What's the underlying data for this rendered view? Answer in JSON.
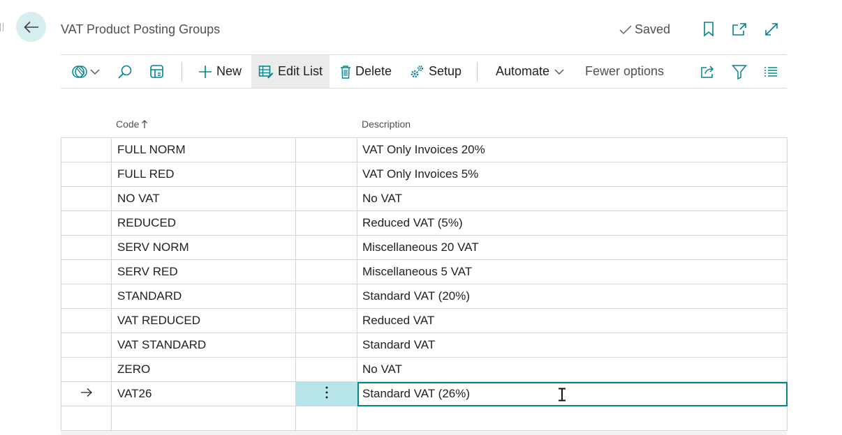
{
  "header": {
    "title": "VAT Product Posting Groups",
    "saved_label": "Saved"
  },
  "toolbar": {
    "new_label": "New",
    "edit_list_label": "Edit List",
    "delete_label": "Delete",
    "setup_label": "Setup",
    "automate_label": "Automate",
    "fewer_options_label": "Fewer options"
  },
  "grid": {
    "columns": {
      "code": "Code",
      "description": "Description"
    },
    "rows": [
      {
        "code": "FULL NORM",
        "description": "VAT Only Invoices 20%"
      },
      {
        "code": "FULL RED",
        "description": "VAT Only Invoices 5%"
      },
      {
        "code": "NO VAT",
        "description": "No VAT"
      },
      {
        "code": "REDUCED",
        "description": "Reduced VAT (5%)"
      },
      {
        "code": "SERV NORM",
        "description": "Miscellaneous 20 VAT"
      },
      {
        "code": "SERV RED",
        "description": "Miscellaneous 5 VAT"
      },
      {
        "code": "STANDARD",
        "description": "Standard VAT (20%)"
      },
      {
        "code": "VAT REDUCED",
        "description": "Reduced VAT"
      },
      {
        "code": "VAT STANDARD",
        "description": "Standard VAT"
      },
      {
        "code": "ZERO",
        "description": "No VAT"
      },
      {
        "code": "VAT26",
        "description": "Standard VAT (26%)"
      }
    ]
  },
  "colors": {
    "accent": "#00838f",
    "selected_cell": "#b6e4e9",
    "back_button": "#d6eef0"
  },
  "icons": [
    "back-arrow-icon",
    "checkmark-icon",
    "bookmark-icon",
    "open-in-new-icon",
    "expand-icon",
    "views-icon",
    "chevron-down-icon",
    "search-icon",
    "layout-icon",
    "plus-icon",
    "edit-list-icon",
    "trash-icon",
    "setup-icon",
    "share-icon",
    "filter-icon",
    "list-icon",
    "sort-up-icon",
    "row-arrow-icon",
    "more-vertical-icon",
    "text-cursor-icon"
  ]
}
